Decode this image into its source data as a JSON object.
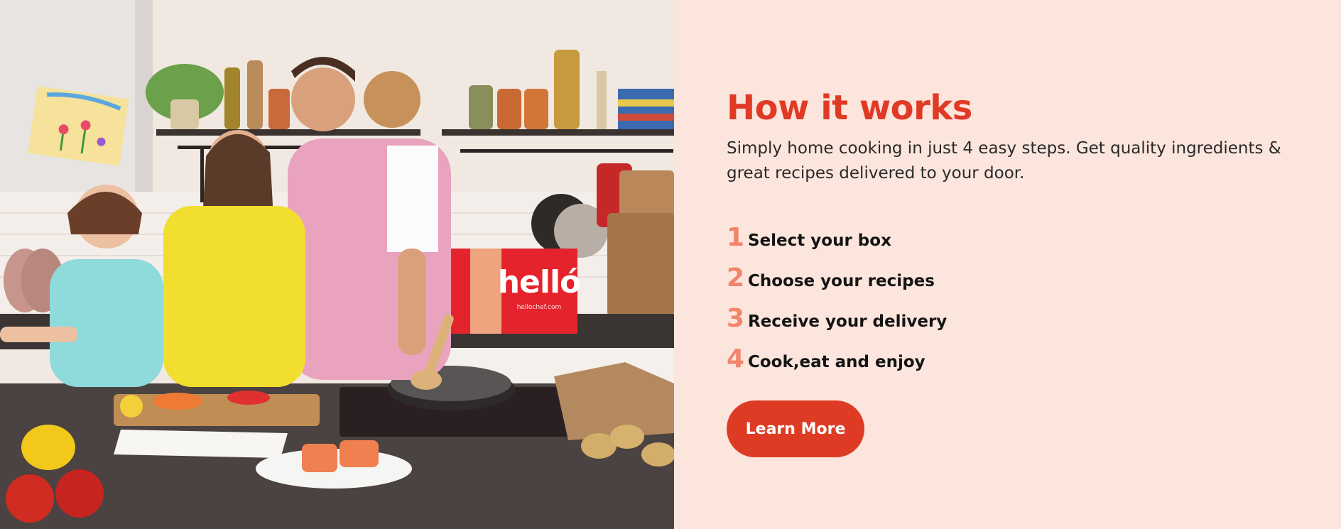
{
  "hero_image": {
    "alt": "Family cooking together in a kitchen with a hello chef box",
    "box_brand": "helló",
    "box_url": "hellochef.com"
  },
  "how_it_works": {
    "title": "How it works",
    "subtitle": "Simply home cooking in just 4 easy steps. Get quality ingredients & great recipes delivered to your door.",
    "steps": [
      {
        "number": "1",
        "label": "Select your box"
      },
      {
        "number": "2",
        "label": "Choose your recipes"
      },
      {
        "number": "3",
        "label": "Receive your delivery"
      },
      {
        "number": "4",
        "label": "Cook,eat and enjoy"
      }
    ],
    "cta_label": "Learn More"
  },
  "colors": {
    "background": "#fbe5dc",
    "title": "#e03a26",
    "step_number": "#f2846a",
    "button": "#de3b24"
  }
}
